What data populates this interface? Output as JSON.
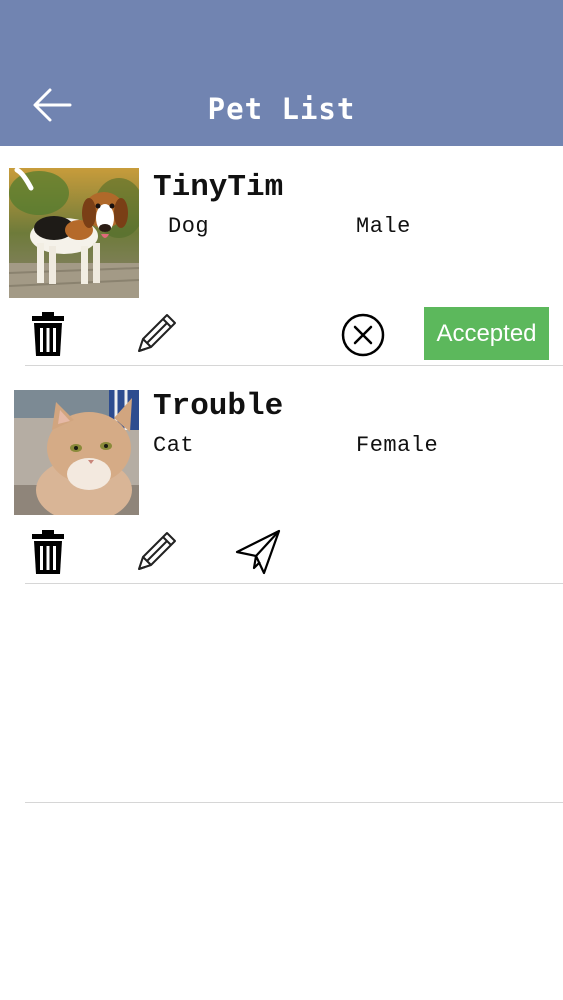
{
  "header": {
    "title": "Pet List",
    "back_icon": "back-arrow-icon",
    "color": "#7184b1"
  },
  "pets": [
    {
      "name": "TinyTim",
      "species": "Dog",
      "gender": "Male",
      "photo_icon": "dog-photo",
      "actions": [
        "trash-icon",
        "pencil-icon",
        "cancel-circle-icon"
      ],
      "status": "Accepted",
      "status_color": "#5cb85c"
    },
    {
      "name": "Trouble",
      "species": "Cat",
      "gender": "Female",
      "photo_icon": "cat-photo",
      "actions": [
        "trash-icon",
        "pencil-icon",
        "send-icon"
      ]
    }
  ]
}
